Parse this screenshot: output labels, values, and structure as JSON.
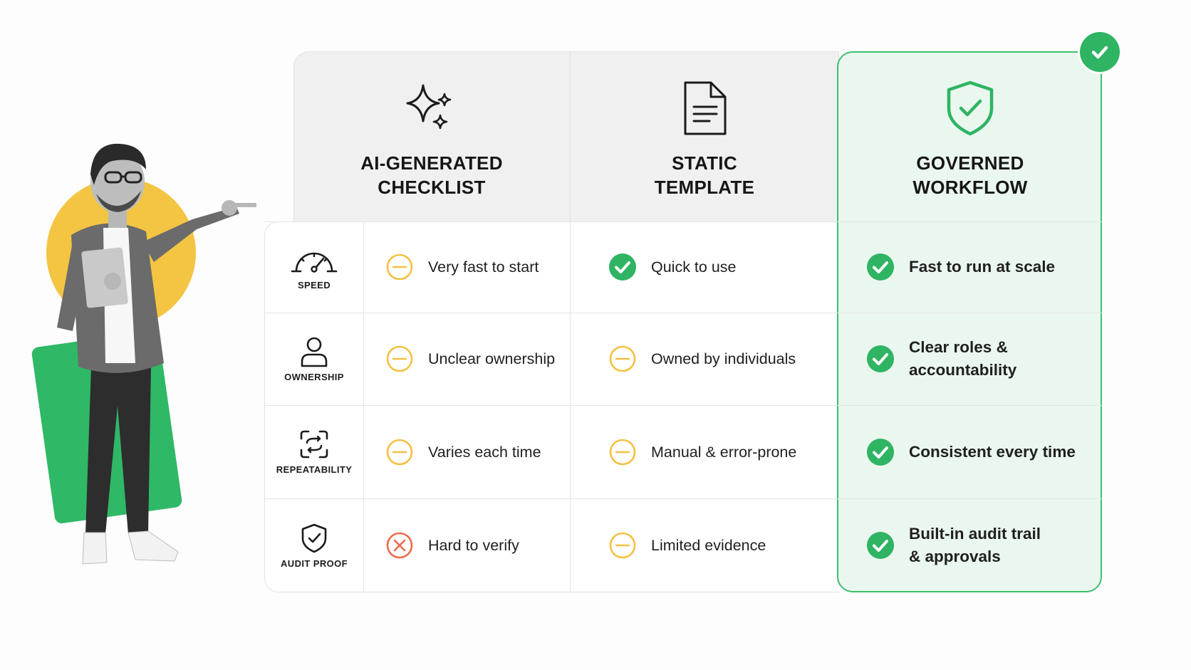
{
  "columns": {
    "ai": {
      "title": "AI-GENERATED\nCHECKLIST",
      "icon": "sparkles-icon"
    },
    "static": {
      "title": "STATIC\nTEMPLATE",
      "icon": "document-icon"
    },
    "governed": {
      "title": "GOVERNED\nWORKFLOW",
      "icon": "shield-check-icon"
    }
  },
  "rows": [
    {
      "criterion": "SPEED",
      "icon": "speedometer-icon",
      "ai": {
        "status": "neutral",
        "text": "Very fast to start"
      },
      "static": {
        "status": "positive",
        "text": "Quick to use"
      },
      "governed": {
        "status": "positive",
        "text": "Fast to run at scale"
      }
    },
    {
      "criterion": "OWNERSHIP",
      "icon": "person-icon",
      "ai": {
        "status": "neutral",
        "text": "Unclear ownership"
      },
      "static": {
        "status": "neutral",
        "text": "Owned by individuals"
      },
      "governed": {
        "status": "positive",
        "text": "Clear roles &\naccountability"
      }
    },
    {
      "criterion": "REPEATABILITY",
      "icon": "repeat-frame-icon",
      "ai": {
        "status": "neutral",
        "text": "Varies each time"
      },
      "static": {
        "status": "neutral",
        "text": "Manual & error-prone"
      },
      "governed": {
        "status": "positive",
        "text": "Consistent every time"
      }
    },
    {
      "criterion": "AUDIT PROOF",
      "icon": "shield-check-small-icon",
      "ai": {
        "status": "negative",
        "text": "Hard to verify"
      },
      "static": {
        "status": "neutral",
        "text": "Limited evidence"
      },
      "governed": {
        "status": "positive",
        "text": "Built-in audit trail\n& approvals"
      }
    }
  ],
  "colors": {
    "positive": "#2eb463",
    "neutral": "#f5c042",
    "negative": "#ee6a4a",
    "governed_bg": "#eaf7ef",
    "governed_border": "#3cbf6f",
    "header_bg": "#f0f0f0",
    "figure_circle": "#f4c542",
    "figure_card": "#2fb866"
  }
}
